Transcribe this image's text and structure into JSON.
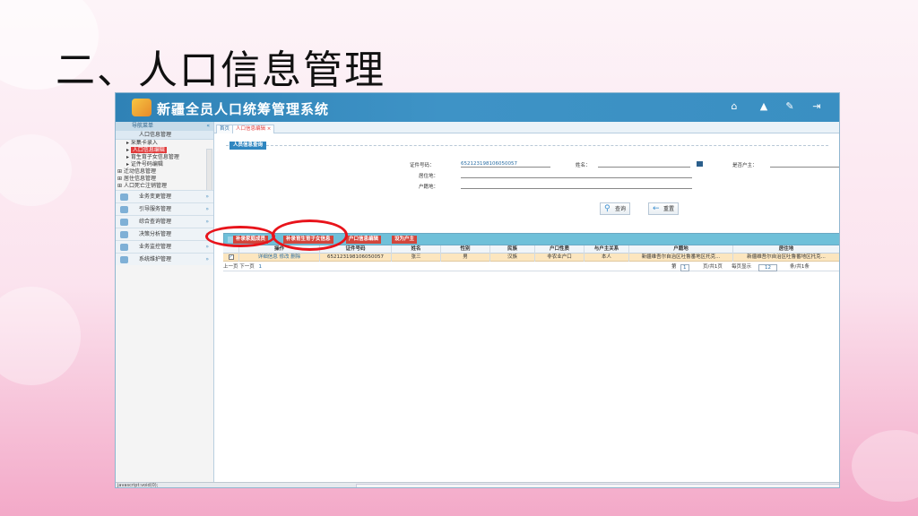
{
  "slide": {
    "title": "二、人口信息管理"
  },
  "app": {
    "title": "新疆全员人口统筹管理系统",
    "header_icons": [
      "home-icon",
      "bell-icon",
      "tools-icon",
      "logout-icon"
    ]
  },
  "sidebar": {
    "heading": "导航菜单",
    "top": "人口信息管理",
    "items": [
      {
        "label": "采集卡录入"
      },
      {
        "label": "人口信息编辑"
      },
      {
        "label": "育生育子女信息管理"
      },
      {
        "label": "证件号码编辑"
      },
      {
        "label": "迁动信息管理"
      },
      {
        "label": "居住信息管理"
      },
      {
        "label": "人口死亡注销管理"
      }
    ],
    "groups": [
      "业务变更管理",
      "引导服务管理",
      "综合查询管理",
      "决策分析管理",
      "业务监控管理",
      "系统维护管理"
    ]
  },
  "tabs": [
    {
      "label": "首页"
    },
    {
      "label": "人口信息编辑 ×"
    }
  ],
  "query": {
    "legend": "人员信息查询",
    "id_label": "证件号码：",
    "id_value": "652123198106050057",
    "name_label": "姓名：",
    "residence_label": "居住地：",
    "hukou_label": "户籍地：",
    "is_head_label": "是否户主：",
    "search_button": "查询",
    "reset_button": "重置"
  },
  "toolbar": {
    "buttons": [
      "补录家庭成员",
      "补录育生育子女信息",
      "户口信息编辑",
      "设为户主"
    ]
  },
  "table": {
    "columns": [
      "操作",
      "证件号码",
      "姓名",
      "性别",
      "民族",
      "户口性质",
      "与户主关系",
      "户籍地",
      "居住地"
    ],
    "row": {
      "actions": [
        "详细信息",
        "修改",
        "删除"
      ],
      "id": "652123198106050057",
      "name": "张三",
      "gender": "男",
      "ethnicity": "汉族",
      "hukou_type": "非农业户口",
      "relation": "本人",
      "hukou_place": "新疆维吾尔自治区吐鲁番地区托克...",
      "residence": "新疆维吾尔自治区吐鲁番地区托克..."
    }
  },
  "pager": {
    "prev_next": "上一页 下一页",
    "page_num": "1",
    "current_page": "1",
    "total_pages": "页/共1页",
    "per_page_label": "每页显示",
    "per_page": "12",
    "total": "条/共1条"
  },
  "status": {
    "text": "javascript:void(0);"
  },
  "colors": {
    "highlight": "#e8141b",
    "header": "#2f82b6",
    "selected_row": "#fce6bf"
  }
}
